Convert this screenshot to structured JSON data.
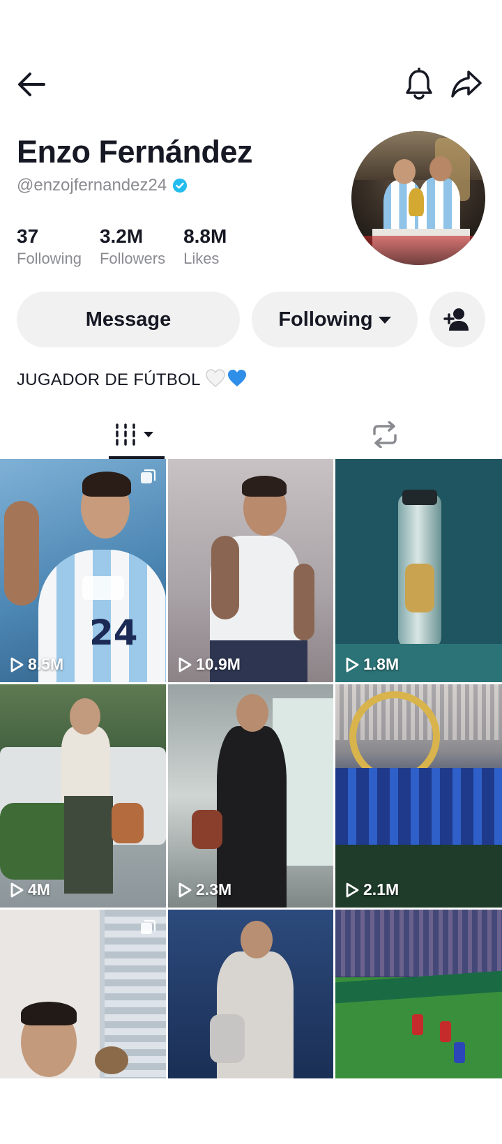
{
  "header": {
    "back_icon": "back-arrow-icon",
    "bell_icon": "bell-icon",
    "share_icon": "share-icon"
  },
  "profile": {
    "name": "Enzo Fernández",
    "handle": "@enzojfernandez24",
    "verified": true,
    "avatar_icon": "profile-photo"
  },
  "stats": [
    {
      "value": "37",
      "label": "Following"
    },
    {
      "value": "3.2M",
      "label": "Followers"
    },
    {
      "value": "8.8M",
      "label": "Likes"
    }
  ],
  "actions": {
    "message_label": "Message",
    "following_label": "Following",
    "add_friend_icon": "add-user-icon"
  },
  "bio": {
    "text": "JUGADOR DE FÚTBOL",
    "emoji": "🤍💙"
  },
  "tabs": [
    {
      "name": "videos",
      "icon": "grid-icon",
      "active": true
    },
    {
      "name": "reposts",
      "icon": "repost-icon",
      "active": false
    }
  ],
  "videos": [
    {
      "views": "8.5M",
      "multi": true
    },
    {
      "views": "10.9M",
      "multi": false
    },
    {
      "views": "1.8M",
      "multi": false
    },
    {
      "views": "4M",
      "multi": false
    },
    {
      "views": "2.3M",
      "multi": false
    },
    {
      "views": "2.1M",
      "multi": false
    },
    {
      "views": "",
      "multi": true
    },
    {
      "views": "",
      "multi": false
    },
    {
      "views": "",
      "multi": false
    }
  ],
  "colors": {
    "text": "#161823",
    "secondary": "#8a8b91",
    "button_bg": "#f1f1f2",
    "verified": "#20d5ec"
  }
}
